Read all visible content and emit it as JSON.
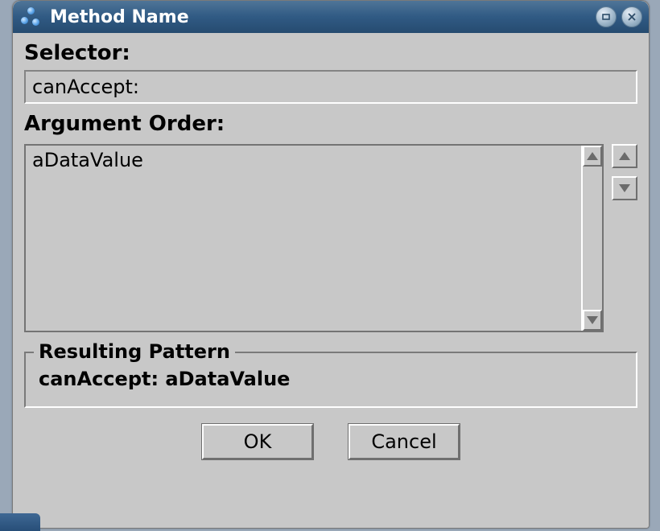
{
  "window": {
    "title": "Method Name"
  },
  "selector": {
    "label": "Selector:",
    "value": "canAccept:"
  },
  "argument_order": {
    "label": "Argument Order:",
    "items": [
      "aDataValue"
    ]
  },
  "resulting_pattern": {
    "legend": "Resulting Pattern",
    "value": "canAccept: aDataValue"
  },
  "buttons": {
    "ok": "OK",
    "cancel": "Cancel"
  }
}
